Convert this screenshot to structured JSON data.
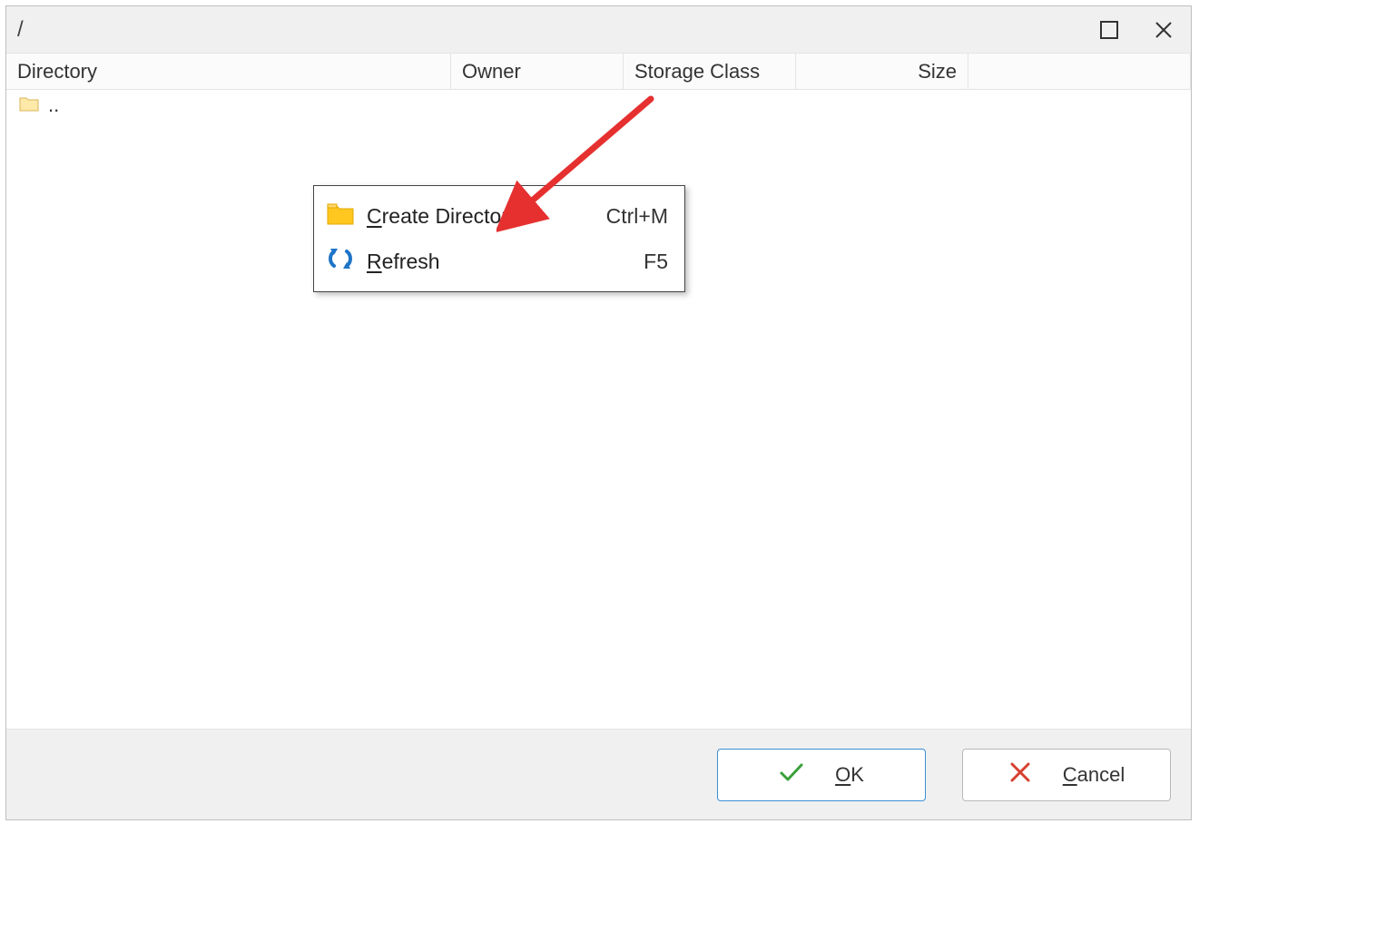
{
  "title": "/",
  "columns": {
    "directory": "Directory",
    "owner": "Owner",
    "storage_class": "Storage Class",
    "size": "Size"
  },
  "rows": [
    {
      "name": ".."
    }
  ],
  "context_menu": {
    "items": [
      {
        "label_pre": "",
        "label_u": "C",
        "label_post": "reate Directory",
        "shortcut": "Ctrl+M",
        "icon": "folder"
      },
      {
        "label_pre": "",
        "label_u": "R",
        "label_post": "efresh",
        "shortcut": "F5",
        "icon": "refresh"
      }
    ]
  },
  "buttons": {
    "ok_u": "O",
    "ok_post": "K",
    "cancel_u": "C",
    "cancel_post": "ancel"
  }
}
